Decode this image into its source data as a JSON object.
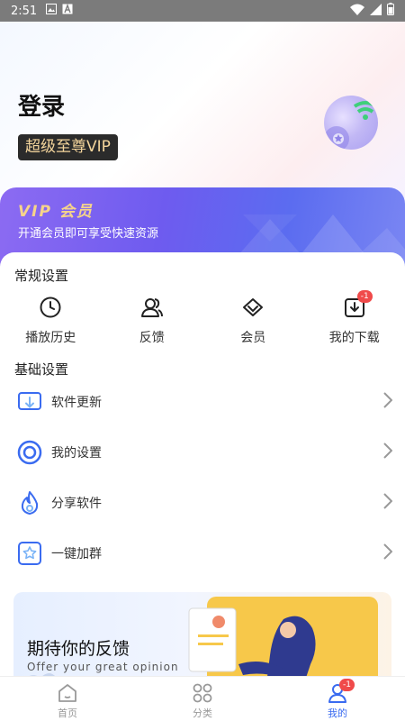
{
  "status_bar": {
    "time": "2:51"
  },
  "header": {
    "login_label": "登录",
    "vip_badge": "超级至尊VIP"
  },
  "vip_banner": {
    "title": "VIP 会员",
    "subtitle": "开通会员即可享受快速资源"
  },
  "general_settings": {
    "title": "常规设置",
    "items": [
      {
        "label": "播放历史",
        "icon": "clock-icon"
      },
      {
        "label": "反馈",
        "icon": "users-icon"
      },
      {
        "label": "会员",
        "icon": "diamond-icon"
      },
      {
        "label": "我的下载",
        "icon": "download-icon",
        "badge": "-1"
      }
    ]
  },
  "basic_settings": {
    "title": "基础设置",
    "items": [
      {
        "label": "软件更新",
        "icon": "update-icon"
      },
      {
        "label": "我的设置",
        "icon": "settings-ring-icon"
      },
      {
        "label": "分享软件",
        "icon": "flame-icon"
      },
      {
        "label": "一键加群",
        "icon": "star-box-icon"
      }
    ]
  },
  "feedback_card": {
    "title": "期待你的反馈",
    "subtitle": "Offer your great opinion"
  },
  "tabbar": {
    "tabs": [
      {
        "label": "首页",
        "icon": "home-icon"
      },
      {
        "label": "分类",
        "icon": "category-icon"
      },
      {
        "label": "我的",
        "icon": "profile-icon",
        "badge": "-1",
        "active": true
      }
    ]
  },
  "colors": {
    "accent": "#3a6bf0",
    "vip_gold": "#f6d48a",
    "badge_red": "#f04a4a",
    "banner_purple": "#7a5df0"
  }
}
